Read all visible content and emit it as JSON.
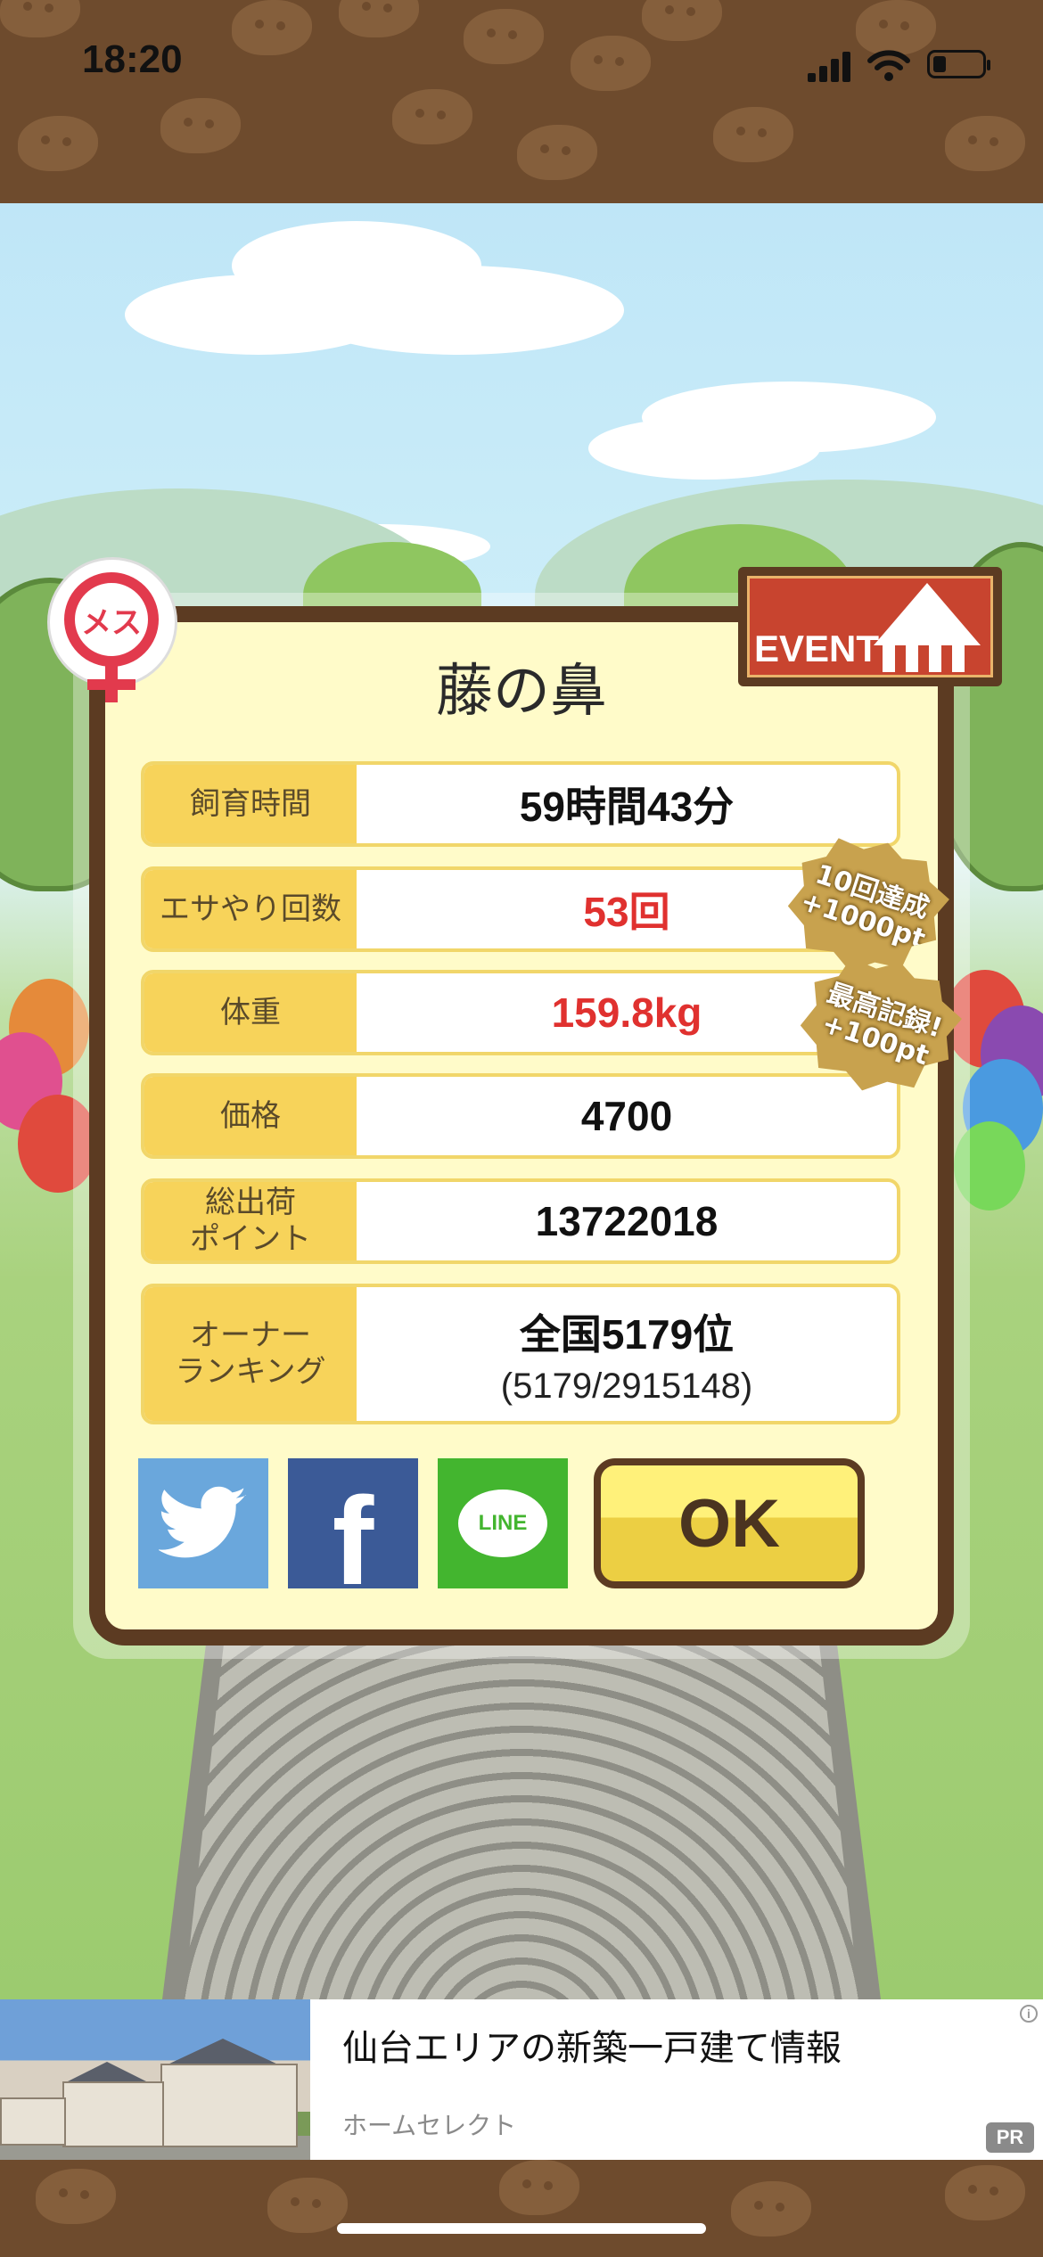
{
  "status_bar": {
    "time": "18:20"
  },
  "dialog": {
    "title": "藤の鼻",
    "gender_label": "メス",
    "event_label": "EVENT",
    "rows": [
      {
        "label": "飼育時間",
        "value": "59時間43分",
        "highlight": false
      },
      {
        "label": "エサやり回数",
        "value": "53回",
        "highlight": true
      },
      {
        "label": "体重",
        "value": "159.8kg",
        "highlight": true
      },
      {
        "label": "価格",
        "value": "4700",
        "highlight": false
      },
      {
        "label_line1": "総出荷",
        "label_line2": "ポイント",
        "value": "13722018",
        "highlight": false
      },
      {
        "label_line1": "オーナー",
        "label_line2": "ランキング",
        "value": "全国5179位",
        "sub": "(5179/2915148)",
        "highlight": false
      }
    ],
    "badges": [
      {
        "line1": "10回達成",
        "line2": "+1000pt"
      },
      {
        "line1": "最高記録!",
        "line2": "+100pt"
      }
    ],
    "share": {
      "line_label": "LINE",
      "facebook_glyph": "f"
    },
    "ok_label": "OK"
  },
  "ad": {
    "title": "仙台エリアの新築一戸建て情報",
    "sponsor": "ホームセレクト",
    "pr_label": "PR",
    "info_glyph": "i"
  },
  "colors": {
    "highlight_red": "#e0312f",
    "label_yellow": "#f7d35a",
    "frame_brown": "#5c3b22",
    "twitter": "#6aa7dc",
    "facebook": "#3b5a97",
    "line": "#43b52f"
  }
}
